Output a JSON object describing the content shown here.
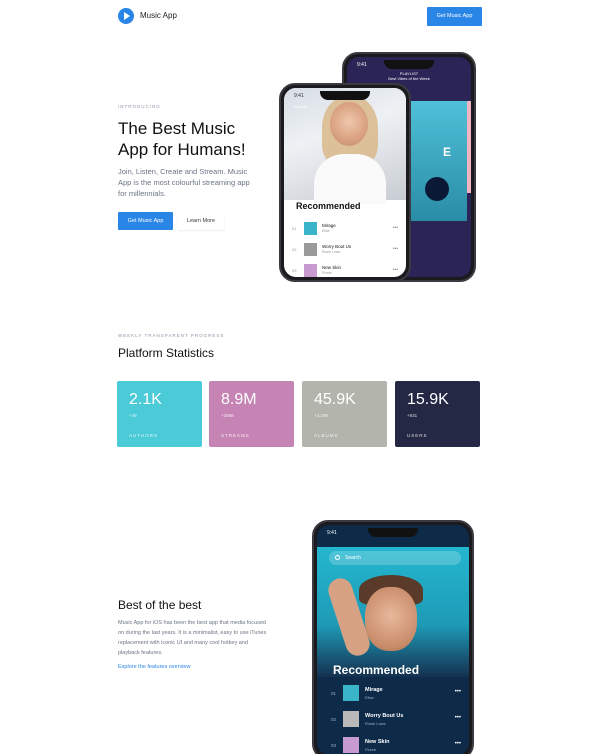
{
  "header": {
    "brand": "Music App",
    "cta": "Get Music App"
  },
  "hero": {
    "kicker": "INTRODUCING",
    "title": "The Best Music App for Humans!",
    "description": "Join, Listen, Create and Stream. Music App is the most colourful streaming app for millennials.",
    "primary_button": "Get Music App",
    "secondary_button": "Learn More"
  },
  "phone_front": {
    "time": "9:41",
    "search": "Search",
    "section": "Recommended",
    "tracks": [
      {
        "num": "01",
        "title": "Mirage",
        "artist": "Elise",
        "color": "#3ab4c8"
      },
      {
        "num": "02",
        "title": "Worry Bout Us",
        "artist": "Rosie Lowe",
        "color": "#9a9a9a"
      },
      {
        "num": "03",
        "title": "New Skin",
        "artist": "Flume",
        "color": "#c79bd0"
      }
    ]
  },
  "phone_back": {
    "time": "9:41",
    "playlist_label": "PLAYLIST",
    "playlist_name": "Best Vibes of the Week",
    "letter": "E"
  },
  "stats": {
    "kicker": "WEEKLY TRANSPARENT PROGRESS",
    "title": "Platform Statistics",
    "cards": [
      {
        "value": "2.1K",
        "delta": "+49",
        "label": "AUTHORS",
        "color": "#4bcbd8"
      },
      {
        "value": "8.9M",
        "delta": "+2568",
        "label": "STREAMS",
        "color": "#c684b4"
      },
      {
        "value": "45.9K",
        "delta": "+3,198",
        "label": "ALBUMS",
        "color": "#b3b5ac"
      },
      {
        "value": "15.9K",
        "delta": "+931",
        "label": "USERS",
        "color": "#242845"
      }
    ]
  },
  "best": {
    "title": "Best of the best",
    "description": "Music App for iOS has been the best app that media focused on during the last years. It is a minimalist, easy to use iTunes replacement with iconic UI and many cool hotkey and playback features.",
    "link": "Explore the features overview"
  },
  "phone_big": {
    "time": "9:41",
    "search": "Search",
    "section": "Recommended",
    "tracks": [
      {
        "num": "01",
        "title": "Mirage",
        "artist": "Elise",
        "color": "#3ab4c8"
      },
      {
        "num": "02",
        "title": "Worry Bout Us",
        "artist": "Rosie Lowe",
        "color": "#b9b9b9"
      },
      {
        "num": "03",
        "title": "New Skin",
        "artist": "Flume",
        "color": "#c79bd0"
      }
    ]
  }
}
